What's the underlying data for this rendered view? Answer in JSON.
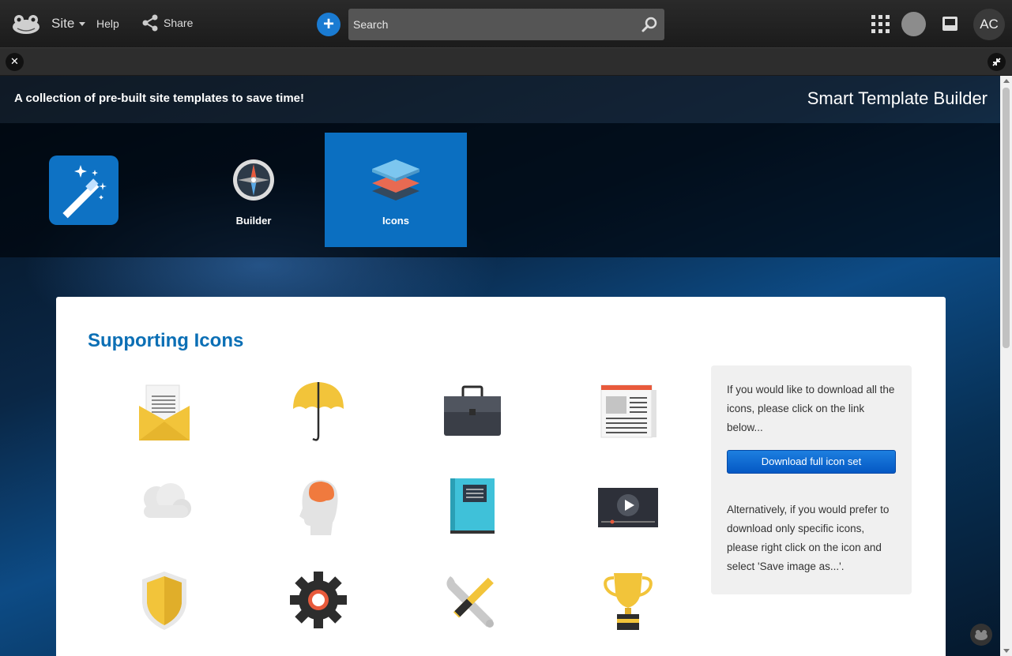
{
  "topbar": {
    "site_label": "Site",
    "help_label": "Help",
    "share_label": "Share",
    "search_placeholder": "Search",
    "avatar_initials": "AC"
  },
  "header": {
    "tagline": "A collection of pre-built site templates to save time!",
    "title": "Smart Template Builder"
  },
  "tabs": [
    {
      "label": "",
      "icon": "magic-wand-icon",
      "active": false
    },
    {
      "label": "Builder",
      "icon": "compass-icon",
      "active": false
    },
    {
      "label": "Icons",
      "icon": "layers-icon",
      "active": true
    }
  ],
  "panel": {
    "title": "Supporting Icons",
    "icons": [
      "envelope-icon",
      "umbrella-icon",
      "briefcase-icon",
      "newspaper-icon",
      "cloud-icon",
      "brain-head-icon",
      "book-icon",
      "video-player-icon",
      "shield-icon",
      "gear-icon",
      "tools-icon",
      "trophy-icon"
    ],
    "info_top": "If you would like to download all the icons, please click on the link below...",
    "download_label": "Download full icon set",
    "info_bottom": "Alternatively, if you would prefer to download only specific icons, please right click on the icon and select 'Save image as...'."
  },
  "colors": {
    "accent": "#0b6fc1",
    "title_blue": "#0b6fb5"
  }
}
